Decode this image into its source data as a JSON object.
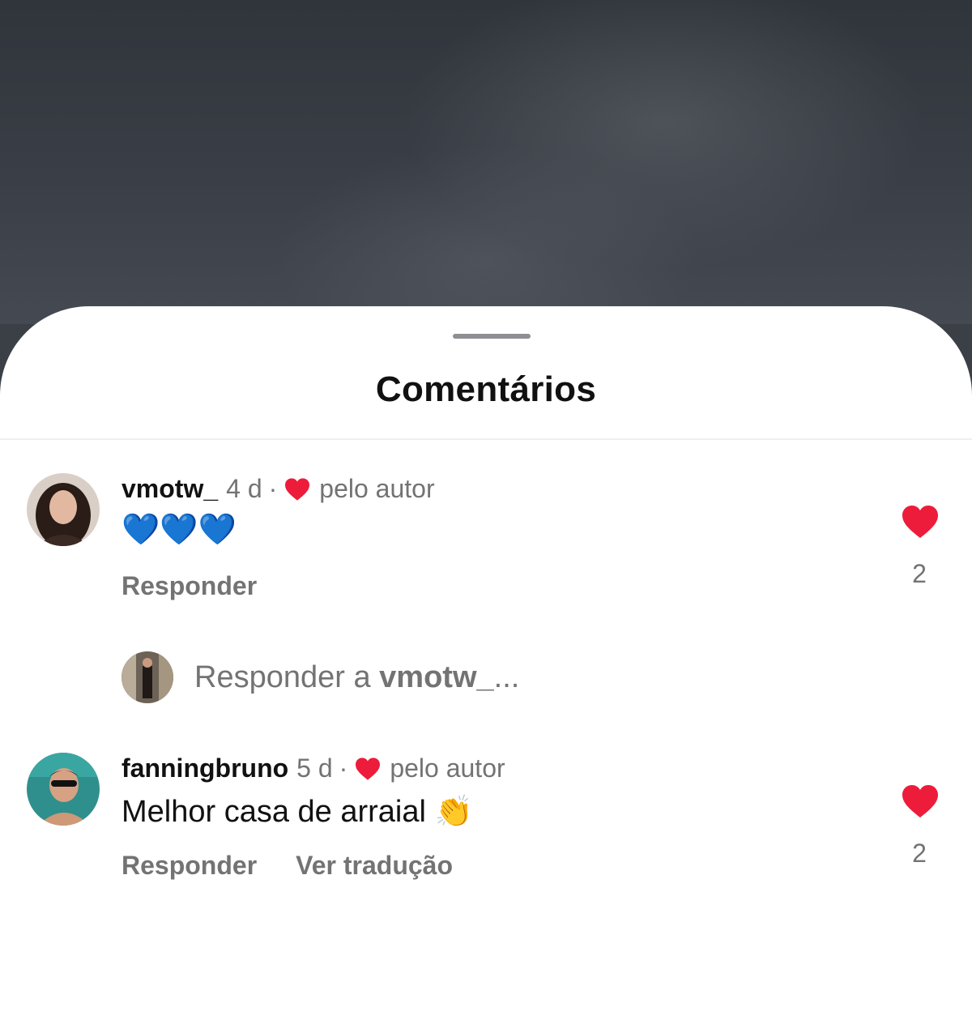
{
  "sheet": {
    "title": "Comentários"
  },
  "comments": [
    {
      "username": "vmotw_",
      "time": "4 d",
      "separator": "·",
      "author_like_label": "pelo autor",
      "text": "💙💙💙",
      "actions": [
        "Responder"
      ],
      "like_count": "2"
    },
    {
      "username": "fanningbruno",
      "time": "5 d",
      "separator": "·",
      "author_like_label": "pelo autor",
      "text": "Melhor casa de arraial 👏",
      "actions": [
        "Responder",
        "Ver tradução"
      ],
      "like_count": "2"
    }
  ],
  "reply_box": {
    "prefix": "Responder a",
    "target": "vmotw_",
    "ellipsis": "..."
  },
  "colors": {
    "like_red": "#ed1c3b",
    "secondary_text": "#737373",
    "primary_text": "#111111"
  },
  "icons": {
    "author_like": "heart-icon",
    "comment_like": "heart-filled-icon"
  }
}
